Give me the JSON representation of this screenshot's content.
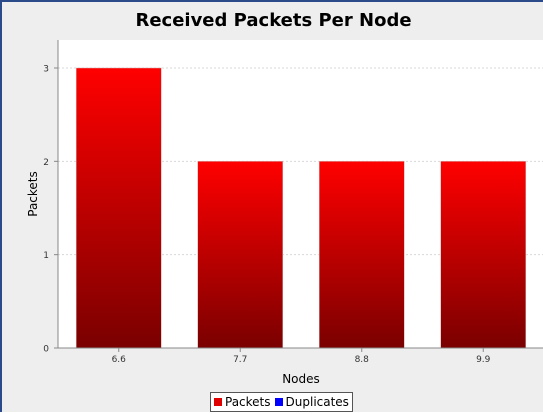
{
  "chart_data": {
    "type": "bar",
    "title": "Received Packets Per Node",
    "xlabel": "Nodes",
    "ylabel": "Packets",
    "categories": [
      "6.6",
      "7.7",
      "8.8",
      "9.9"
    ],
    "series": [
      {
        "name": "Packets",
        "values": [
          3,
          2,
          2,
          2
        ],
        "color": "#e00000"
      },
      {
        "name": "Duplicates",
        "values": [
          0,
          0,
          0,
          0
        ],
        "color": "#0000ff"
      }
    ],
    "ylim": [
      0,
      3.3
    ],
    "yticks": [
      "0",
      "1",
      "2",
      "3"
    ],
    "grid": true,
    "legend_position": "bottom"
  }
}
